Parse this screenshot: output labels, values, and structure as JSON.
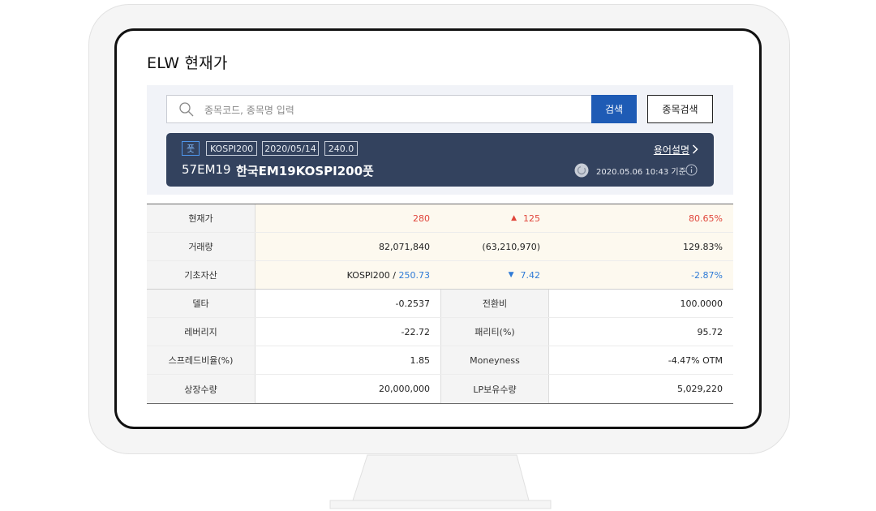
{
  "page": {
    "title": "ELW 현재가"
  },
  "search": {
    "placeholder": "종목코드, 종목명 입력",
    "button_label": "검색",
    "stock_search_label": "종목검색"
  },
  "card": {
    "tags": [
      "풋",
      "KOSPI200",
      "2020/05/14",
      "240.0"
    ],
    "code": "57EM19",
    "name": "한국EM19KOSPI200풋",
    "glossary_label": "용어설명",
    "timestamp": "2020.05.06 10:43 기준"
  },
  "quote": {
    "price_label": "현재가",
    "price": "280",
    "change_arrow": "▲",
    "change": "125",
    "change_pct": "80.65%",
    "volume_label": "거래량",
    "volume": "82,071,840",
    "volume_change": "(63,210,970)",
    "volume_pct": "129.83%",
    "underlying_label": "기초자산",
    "underlying_name": "KOSPI200 / ",
    "underlying_price": "250.73",
    "underlying_arrow": "▼",
    "underlying_change": "7.42",
    "underlying_pct": "-2.87%"
  },
  "metrics": {
    "delta_label": "델타",
    "delta": "-0.2537",
    "conversion_label": "전환비",
    "conversion": "100.0000",
    "leverage_label": "레버리지",
    "leverage": "-22.72",
    "parity_label": "패리티(%)",
    "parity": "95.72",
    "spread_label": "스프레드비율(%)",
    "spread": "1.85",
    "moneyness_label": "Moneyness",
    "moneyness": "-4.47% OTM",
    "listed_label": "상장수량",
    "listed": "20,000,000",
    "lp_label": "LP보유수량",
    "lp": "5,029,220"
  },
  "colors": {
    "up": "#e0463b",
    "down": "#2f7ad6",
    "card_bg": "#33425e",
    "button_bg": "#1e5bb5"
  }
}
